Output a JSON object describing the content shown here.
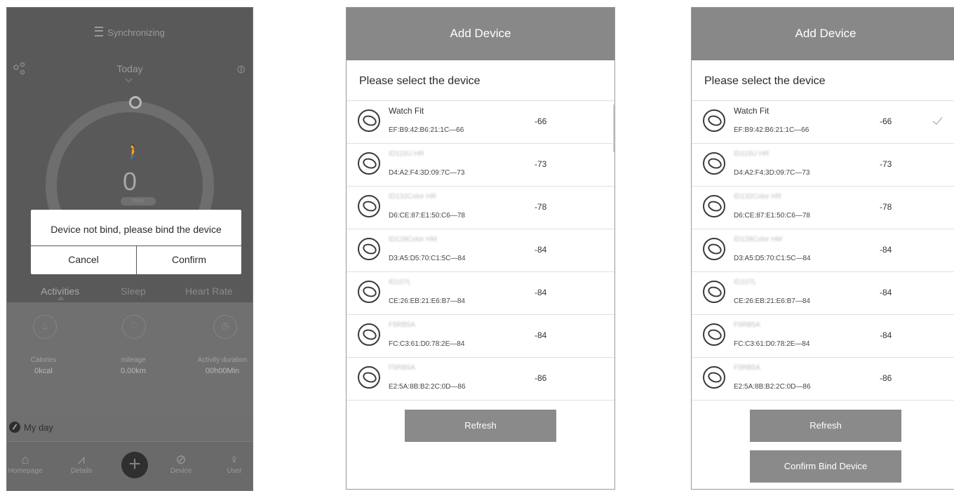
{
  "home": {
    "sync_text": "Synchronizing",
    "date_label": "Today",
    "steps_value": "0",
    "steps_unit": "steps",
    "dialog": {
      "message": "Device not bind, please bind the device",
      "cancel": "Cancel",
      "confirm": "Confirm"
    },
    "tabs": [
      "Activities",
      "Sleep",
      "Heart Rate"
    ],
    "stats": [
      {
        "label": "Calories",
        "value": "0kcal",
        "icon": "flame-icon"
      },
      {
        "label": "mileage",
        "value": "0.00km",
        "icon": "location-pin-icon"
      },
      {
        "label": "Activity duration",
        "value": "00h00Min",
        "icon": "clock-icon"
      }
    ],
    "my_day": "My day",
    "nav": [
      "Homepage",
      "Details",
      "Device",
      "User"
    ]
  },
  "add_device": {
    "title": "Add Device",
    "subtitle": "Please select the device",
    "refresh": "Refresh",
    "confirm_bind": "Confirm Bind Device",
    "selected_index": 0,
    "devices": [
      {
        "name": "Watch Fit",
        "mac": "EF:B9:42:B6:21:1C—66",
        "rssi": "-66"
      },
      {
        "name": "ID115U HR",
        "mac": "D4:A2:F4:3D:09:7C—73",
        "rssi": "-73"
      },
      {
        "name": "ID132Color HR",
        "mac": "D6:CE:87:E1:50:C6—78",
        "rssi": "-78"
      },
      {
        "name": "ID128Color HM",
        "mac": "D3:A5:D5:70:C1:5C—84",
        "rssi": "-84"
      },
      {
        "name": "ID107L",
        "mac": "CE:26:EB:21:E6:B7—84",
        "rssi": "-84"
      },
      {
        "name": "F5RB5A",
        "mac": "FC:C3:61:D0:78:2E—84",
        "rssi": "-84"
      },
      {
        "name": "F5RB5A",
        "mac": "E2:5A:8B:B2:2C:0D—86",
        "rssi": "-86"
      }
    ]
  },
  "colors": {
    "header_gray": "#888888",
    "overlay_gray": "#5d5d5d",
    "button_gray": "#8a8a8a"
  }
}
